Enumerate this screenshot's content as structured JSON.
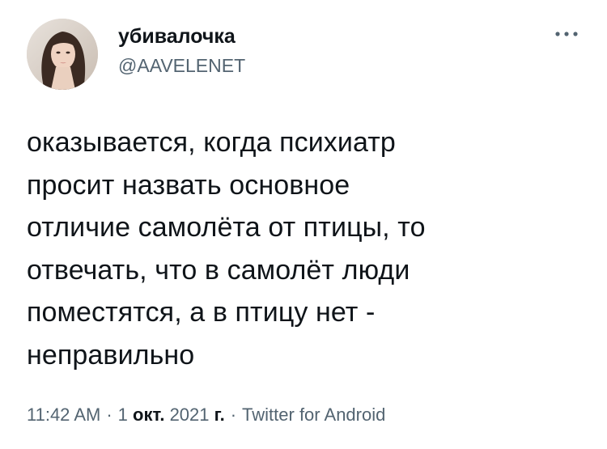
{
  "author": {
    "display_name": "убивалочка",
    "handle": "@AAVELENET",
    "avatar": "profile-photo"
  },
  "more_icon": "ellipsis-icon",
  "tweet": {
    "lines": [
      "оказывается, когда психиатр",
      "просит назвать основное",
      "отличие самолёта от птицы, то",
      "отвечать, что в самолёт люди",
      "поместятся, а в птицу нет -",
      "неправильно"
    ]
  },
  "meta": {
    "time": "11:42 AM",
    "separator": "·",
    "date_day": "1",
    "date_month": "окт.",
    "date_year": "2021",
    "date_suffix": "г.",
    "source": "Twitter for Android"
  },
  "colors": {
    "text": "#0f1419",
    "secondary": "#536471",
    "background": "#ffffff"
  }
}
